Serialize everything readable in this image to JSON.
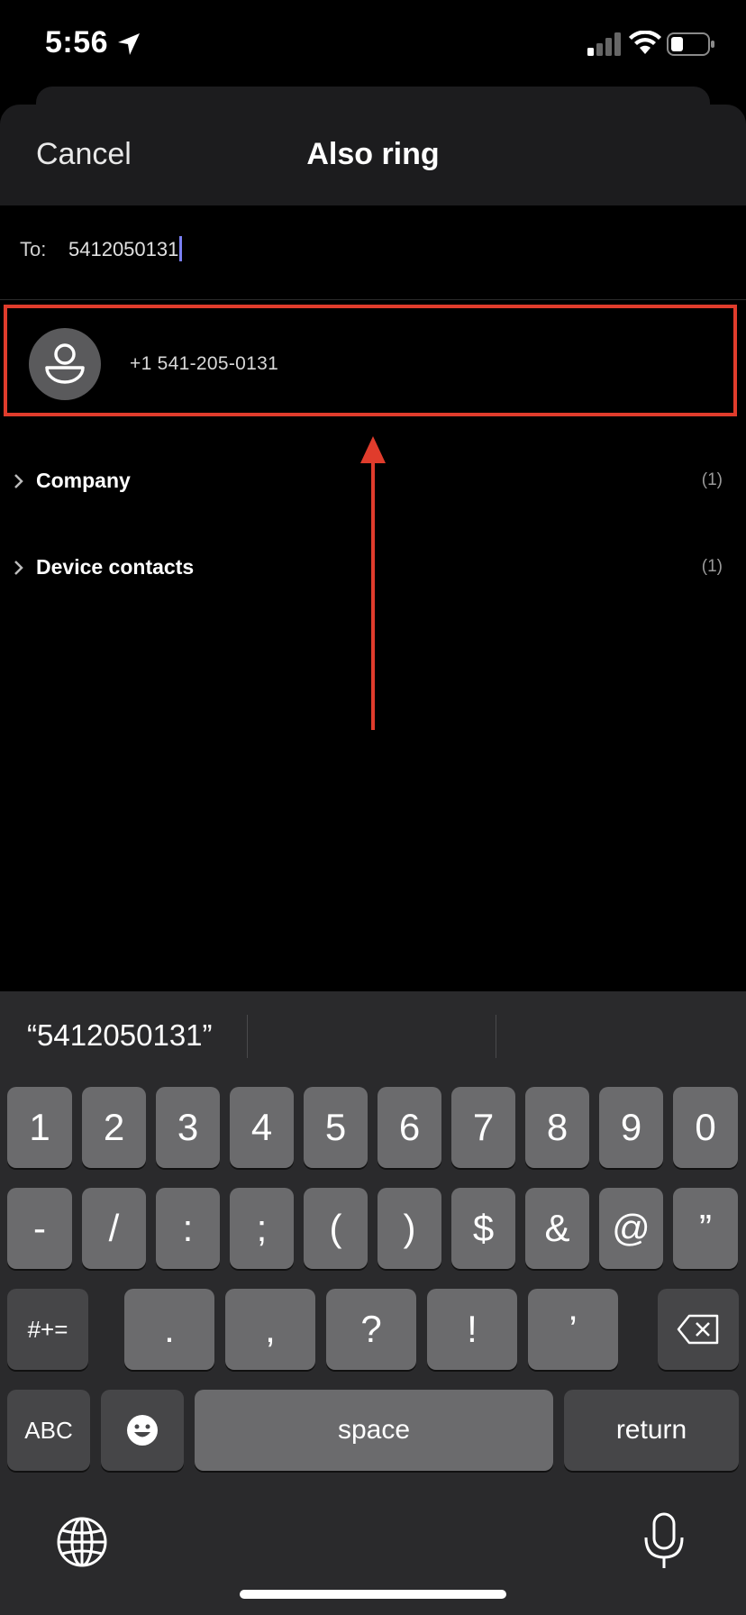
{
  "status_bar": {
    "time": "5:56"
  },
  "header": {
    "cancel_label": "Cancel",
    "title": "Also ring"
  },
  "to_field": {
    "label": "To:",
    "value": "5412050131"
  },
  "result": {
    "number": "+1 541-205-0131"
  },
  "groups": [
    {
      "label": "Company",
      "count": "(1)"
    },
    {
      "label": "Device contacts",
      "count": "(1)"
    }
  ],
  "keyboard": {
    "suggestion": "“5412050131”",
    "row1": [
      "1",
      "2",
      "3",
      "4",
      "5",
      "6",
      "7",
      "8",
      "9",
      "0"
    ],
    "row2": [
      "-",
      "/",
      ":",
      ";",
      "(",
      ")",
      "$",
      "&",
      "@",
      "”"
    ],
    "row3": {
      "mode": "#+=",
      "keys": [
        ".",
        ",",
        "?",
        "!",
        "’"
      ]
    },
    "row4": {
      "abc": "ABC",
      "space": "space",
      "return": "return"
    }
  },
  "colors": {
    "highlight": "#e03c2c",
    "caret": "#7a7ff2"
  }
}
